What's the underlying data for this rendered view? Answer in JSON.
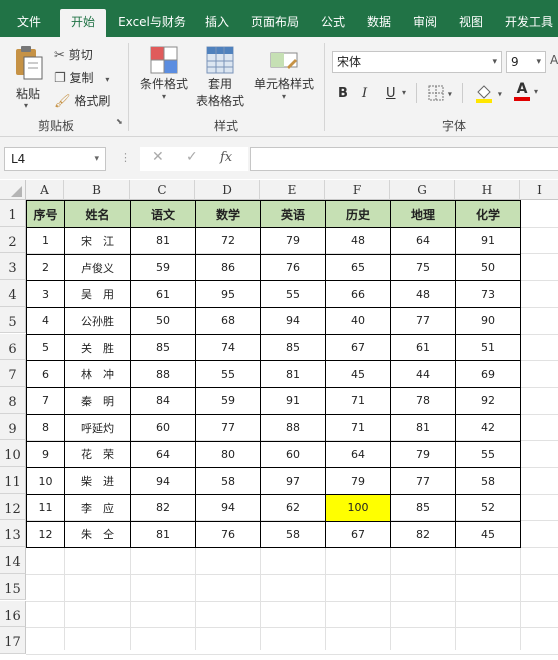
{
  "tabs": [
    "文件",
    "开始",
    "Excel与财务",
    "插入",
    "页面布局",
    "公式",
    "数据",
    "审阅",
    "视图",
    "开发工具"
  ],
  "clipboard": {
    "paste": "粘贴",
    "cut": "剪切",
    "copy": "复制",
    "format_painter": "格式刷",
    "group": "剪贴板"
  },
  "styles": {
    "conditional": "条件格式",
    "table_format_1": "套用",
    "table_format_2": "表格格式",
    "cell_styles": "单元格样式",
    "group": "样式"
  },
  "font": {
    "name": "宋体",
    "size": "9",
    "bold": "B",
    "italic": "I",
    "underline": "U",
    "font_color_letter": "A",
    "group": "字体",
    "fill_color": "#FFE600",
    "text_color": "#E00000"
  },
  "formula_bar": {
    "name_box": "L4",
    "fx": "fx",
    "formula": ""
  },
  "columns": [
    "A",
    "B",
    "C",
    "D",
    "E",
    "F",
    "G",
    "H",
    "I"
  ],
  "rows": [
    "1",
    "2",
    "3",
    "4",
    "5",
    "6",
    "7",
    "8",
    "9",
    "10",
    "11",
    "12",
    "13",
    "14",
    "15",
    "16",
    "17"
  ],
  "table": {
    "header": [
      "序号",
      "姓名",
      "语文",
      "数学",
      "英语",
      "历史",
      "地理",
      "化学"
    ],
    "rows": [
      [
        "1",
        "宋　江",
        "81",
        "72",
        "79",
        "48",
        "64",
        "91"
      ],
      [
        "2",
        "卢俊义",
        "59",
        "86",
        "76",
        "65",
        "75",
        "50"
      ],
      [
        "3",
        "吴　用",
        "61",
        "95",
        "55",
        "66",
        "48",
        "73"
      ],
      [
        "4",
        "公孙胜",
        "50",
        "68",
        "94",
        "40",
        "77",
        "90"
      ],
      [
        "5",
        "关　胜",
        "85",
        "74",
        "85",
        "67",
        "61",
        "51"
      ],
      [
        "6",
        "林　冲",
        "88",
        "55",
        "81",
        "45",
        "44",
        "69"
      ],
      [
        "7",
        "秦　明",
        "84",
        "59",
        "91",
        "71",
        "78",
        "92"
      ],
      [
        "8",
        "呼延灼",
        "60",
        "77",
        "88",
        "71",
        "81",
        "42"
      ],
      [
        "9",
        "花　荣",
        "64",
        "80",
        "60",
        "64",
        "79",
        "55"
      ],
      [
        "10",
        "柴　进",
        "94",
        "58",
        "97",
        "79",
        "77",
        "58"
      ],
      [
        "11",
        "李　应",
        "82",
        "94",
        "62",
        "100",
        "85",
        "52"
      ],
      [
        "12",
        "朱　仝",
        "81",
        "76",
        "58",
        "67",
        "82",
        "45"
      ]
    ],
    "header_fill": "#C6E0B4",
    "highlight_fill": "#FFFF00"
  }
}
